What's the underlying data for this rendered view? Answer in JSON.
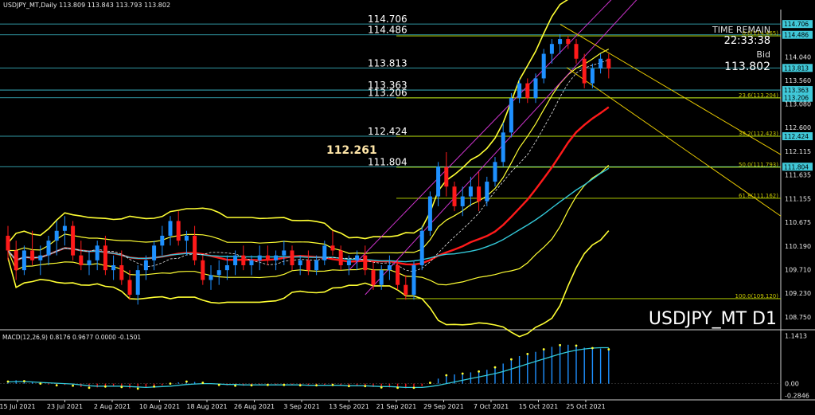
{
  "header": {
    "text": "USDJPY_MT,Daily  113.809 113.843 113.793 113.802"
  },
  "macd_header": "MACD(12,26,9) 0.8176 0.9677 0.0000 -0.1501",
  "info": {
    "time_remain_label": "TIME REMAIN",
    "time_remain": "22:33:38",
    "bid_label": "Bid",
    "bid": "113.802"
  },
  "symbol_label": "USDJPY_MT D1",
  "highlight_price": "112.261",
  "colors": {
    "bull": "#1e90ff",
    "bear": "#ff1a1a",
    "level": "#40c8d8",
    "fib": "#c8e600",
    "bb": "#ffff33",
    "ma_red": "#ff1a1a",
    "ma_cyan": "#33c8d8",
    "channel": "#cc33cc",
    "fan": "#e6c800"
  },
  "chart_data": [
    {
      "type": "candlestick",
      "title": "USDJPY_MT D1",
      "ylim": [
        108.52,
        115.0
      ],
      "price_axis_labels": [
        "114.040",
        "113.560",
        "113.080",
        "112.600",
        "112.115",
        "111.635",
        "111.155",
        "110.675",
        "110.190",
        "109.710",
        "109.230",
        "108.750"
      ],
      "date_labels": [
        "15 Jul 2021",
        "23 Jul 2021",
        "2 Aug 2021",
        "10 Aug 2021",
        "18 Aug 2021",
        "26 Aug 2021",
        "3 Sep 2021",
        "13 Sep 2021",
        "21 Sep 2021",
        "29 Sep 2021",
        "7 Oct 2021",
        "15 Oct 2021",
        "25 Oct 2021"
      ],
      "levels": [
        {
          "price": 114.706,
          "label": "114.706"
        },
        {
          "price": 114.486,
          "label": "114.486"
        },
        {
          "price": 113.813,
          "label": "113.813"
        },
        {
          "price": 113.363,
          "label": "113.363"
        },
        {
          "price": 113.206,
          "label": "113.206"
        },
        {
          "price": 112.424,
          "label": "112.424"
        },
        {
          "price": 111.804,
          "label": "111.804"
        }
      ],
      "fib_levels": [
        {
          "price": 114.465,
          "label": "0.0(114.465)"
        },
        {
          "price": 113.204,
          "label": "23.6(113.204)"
        },
        {
          "price": 112.423,
          "label": "38.2(112.423)"
        },
        {
          "price": 111.793,
          "label": "50.0(111.793)"
        },
        {
          "price": 111.162,
          "label": "61.8(111.162)"
        },
        {
          "price": 109.12,
          "label": "100.0(109.120)"
        }
      ],
      "candles": [
        [
          110.4,
          110.6,
          109.9,
          110.1
        ],
        [
          110.1,
          110.3,
          109.5,
          109.7
        ],
        [
          109.7,
          110.2,
          109.6,
          110.1
        ],
        [
          110.1,
          110.5,
          109.8,
          109.9
        ],
        [
          109.9,
          110.2,
          109.6,
          110.0
        ],
        [
          110.0,
          110.4,
          109.8,
          110.3
        ],
        [
          110.3,
          110.7,
          110.0,
          110.5
        ],
        [
          110.5,
          110.8,
          110.2,
          110.6
        ],
        [
          110.6,
          110.7,
          109.9,
          110.0
        ],
        [
          110.0,
          110.3,
          109.7,
          109.8
        ],
        [
          109.8,
          110.1,
          109.6,
          109.9
        ],
        [
          109.9,
          110.3,
          109.7,
          110.2
        ],
        [
          110.2,
          110.4,
          109.6,
          109.7
        ],
        [
          109.7,
          110.0,
          109.5,
          109.8
        ],
        [
          109.8,
          110.1,
          109.4,
          109.5
        ],
        [
          109.5,
          109.7,
          109.1,
          109.2
        ],
        [
          109.2,
          109.8,
          109.0,
          109.7
        ],
        [
          109.7,
          110.0,
          109.5,
          109.9
        ],
        [
          109.9,
          110.3,
          109.7,
          110.2
        ],
        [
          110.2,
          110.6,
          110.0,
          110.4
        ],
        [
          110.4,
          110.8,
          110.2,
          110.7
        ],
        [
          110.7,
          110.9,
          110.2,
          110.3
        ],
        [
          110.3,
          110.5,
          110.0,
          110.4
        ],
        [
          110.4,
          110.6,
          109.8,
          109.9
        ],
        [
          109.9,
          110.0,
          109.4,
          109.5
        ],
        [
          109.5,
          109.8,
          109.3,
          109.6
        ],
        [
          109.6,
          109.9,
          109.4,
          109.7
        ],
        [
          109.7,
          110.0,
          109.5,
          109.8
        ],
        [
          109.8,
          110.1,
          109.6,
          110.0
        ],
        [
          110.0,
          110.2,
          109.7,
          109.8
        ],
        [
          109.8,
          110.0,
          109.6,
          109.9
        ],
        [
          109.9,
          110.2,
          109.7,
          110.0
        ],
        [
          110.0,
          110.2,
          109.8,
          109.9
        ],
        [
          109.9,
          110.1,
          109.7,
          110.0
        ],
        [
          110.0,
          110.3,
          109.8,
          110.1
        ],
        [
          110.1,
          110.2,
          109.7,
          109.8
        ],
        [
          109.8,
          110.0,
          109.6,
          109.9
        ],
        [
          109.9,
          110.1,
          109.6,
          109.7
        ],
        [
          109.7,
          110.0,
          109.6,
          109.9
        ],
        [
          109.9,
          110.3,
          109.8,
          110.2
        ],
        [
          110.2,
          110.5,
          110.0,
          110.1
        ],
        [
          110.1,
          110.2,
          109.7,
          109.8
        ],
        [
          109.8,
          110.0,
          109.6,
          109.9
        ],
        [
          109.9,
          110.1,
          109.7,
          110.0
        ],
        [
          110.0,
          110.2,
          109.6,
          109.7
        ],
        [
          109.7,
          109.9,
          109.3,
          109.4
        ],
        [
          109.4,
          109.8,
          109.3,
          109.7
        ],
        [
          109.7,
          110.0,
          109.5,
          109.8
        ],
        [
          109.8,
          109.9,
          109.3,
          109.4
        ],
        [
          109.4,
          109.6,
          109.1,
          109.2
        ],
        [
          109.2,
          109.9,
          109.1,
          109.8
        ],
        [
          109.8,
          110.6,
          109.7,
          110.5
        ],
        [
          110.5,
          111.3,
          110.4,
          111.2
        ],
        [
          111.2,
          111.9,
          111.0,
          111.8
        ],
        [
          111.8,
          112.1,
          111.2,
          111.4
        ],
        [
          111.4,
          111.5,
          110.9,
          111.0
        ],
        [
          111.0,
          111.4,
          110.8,
          111.2
        ],
        [
          111.2,
          111.6,
          111.0,
          111.4
        ],
        [
          111.4,
          111.7,
          110.9,
          111.1
        ],
        [
          111.1,
          111.6,
          111.0,
          111.5
        ],
        [
          111.5,
          112.0,
          111.4,
          111.9
        ],
        [
          111.9,
          112.7,
          111.8,
          112.5
        ],
        [
          112.5,
          113.3,
          112.4,
          113.2
        ],
        [
          113.2,
          113.6,
          113.1,
          113.5
        ],
        [
          113.5,
          113.6,
          113.1,
          113.2
        ],
        [
          113.2,
          113.7,
          113.1,
          113.6
        ],
        [
          113.6,
          114.2,
          113.5,
          114.1
        ],
        [
          114.1,
          114.4,
          113.9,
          114.3
        ],
        [
          114.3,
          114.5,
          114.1,
          114.4
        ],
        [
          114.4,
          114.47,
          114.2,
          114.3
        ],
        [
          114.3,
          114.4,
          113.9,
          114.0
        ],
        [
          114.0,
          114.1,
          113.4,
          113.5
        ],
        [
          113.5,
          113.9,
          113.4,
          113.8
        ],
        [
          113.8,
          114.1,
          113.7,
          114.0
        ],
        [
          114.0,
          114.1,
          113.6,
          113.8
        ]
      ]
    },
    {
      "type": "bar",
      "title": "MACD(12,26,9)",
      "ylim": [
        -0.35,
        1.25
      ],
      "price_axis_labels": [
        "1.1413",
        "0.00",
        "-0.2846"
      ],
      "histogram": [
        0.05,
        0.08,
        0.06,
        0.03,
        0.0,
        -0.02,
        -0.04,
        -0.03,
        -0.05,
        -0.08,
        -0.1,
        -0.09,
        -0.07,
        -0.06,
        -0.08,
        -0.11,
        -0.12,
        -0.1,
        -0.07,
        -0.04,
        0.0,
        0.03,
        0.05,
        0.04,
        0.02,
        -0.01,
        -0.03,
        -0.04,
        -0.05,
        -0.05,
        -0.04,
        -0.03,
        -0.03,
        -0.04,
        -0.03,
        -0.03,
        -0.04,
        -0.05,
        -0.04,
        -0.04,
        -0.03,
        -0.05,
        -0.06,
        -0.05,
        -0.06,
        -0.08,
        -0.09,
        -0.09,
        -0.1,
        -0.11,
        -0.1,
        -0.06,
        0.02,
        0.12,
        0.2,
        0.22,
        0.24,
        0.27,
        0.29,
        0.33,
        0.39,
        0.48,
        0.58,
        0.66,
        0.71,
        0.76,
        0.82,
        0.88,
        0.92,
        0.93,
        0.91,
        0.86,
        0.85,
        0.84,
        0.82
      ],
      "signal": [
        0.04,
        0.05,
        0.05,
        0.04,
        0.03,
        0.02,
        0.01,
        0.0,
        -0.01,
        -0.03,
        -0.05,
        -0.06,
        -0.06,
        -0.06,
        -0.06,
        -0.07,
        -0.08,
        -0.09,
        -0.08,
        -0.07,
        -0.06,
        -0.04,
        -0.02,
        -0.01,
        0.0,
        0.0,
        -0.01,
        -0.02,
        -0.02,
        -0.03,
        -0.03,
        -0.03,
        -0.03,
        -0.03,
        -0.03,
        -0.03,
        -0.03,
        -0.04,
        -0.04,
        -0.04,
        -0.04,
        -0.04,
        -0.05,
        -0.05,
        -0.05,
        -0.06,
        -0.07,
        -0.07,
        -0.08,
        -0.09,
        -0.09,
        -0.09,
        -0.07,
        -0.04,
        0.0,
        0.04,
        0.08,
        0.12,
        0.16,
        0.2,
        0.24,
        0.29,
        0.35,
        0.41,
        0.47,
        0.53,
        0.59,
        0.65,
        0.71,
        0.76,
        0.8,
        0.83,
        0.85,
        0.86,
        0.86
      ]
    }
  ]
}
